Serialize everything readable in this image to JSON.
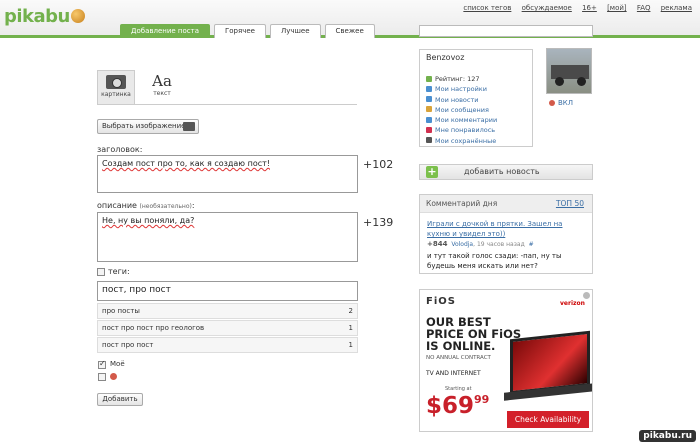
{
  "header": {
    "logo": "pikabu",
    "toplinks": [
      "список тегов",
      "обсуждаемое",
      "16+",
      "[мой]",
      "FAQ",
      "реклама"
    ],
    "nav_tabs": [
      "Добавление поста",
      "Горячее",
      "Лучшее",
      "Свежее"
    ]
  },
  "editor": {
    "type_tab_picture": "картинка",
    "type_tab_text_glyph": "Aa",
    "type_tab_text": "текст",
    "select_image_label": "Выбрать изображение",
    "title_label": "заголовок:",
    "title_value": "Создам пост про то, как я создаю пост!",
    "title_counter": "+102",
    "desc_label": "описание",
    "desc_label_note": "(необязательно)",
    "desc_value": "Не, ну вы поняли, да?",
    "desc_counter": "+139",
    "tags_label": "теги:",
    "tags_value": "пост, про пост",
    "tag_suggestions": [
      {
        "name": "про посты",
        "count": "2"
      },
      {
        "name": "пост про пост про геологов",
        "count": "1"
      },
      {
        "name": "пост про пост",
        "count": "1"
      }
    ],
    "moe_label": "Моё",
    "add_button": "Добавить"
  },
  "sidebar": {
    "username": "Benzovoz",
    "menu": [
      {
        "label": "Рейтинг: 127",
        "color": "#73b14d"
      },
      {
        "label": "Мои настройки",
        "color": "#4a8fd0"
      },
      {
        "label": "Мои новости",
        "color": "#4a8fd0"
      },
      {
        "label": "Мои сообщения",
        "color": "#d8a33a"
      },
      {
        "label": "Мои комментарии",
        "color": "#4a8fd0"
      },
      {
        "label": "Мне понравилось",
        "color": "#d03050"
      },
      {
        "label": "Мои сохранённые",
        "color": "#555555"
      }
    ],
    "vkl_label": "ВКЛ",
    "add_news": "добавить новость",
    "comment_day_title": "Комментарий дня",
    "top50": "ТОП 50",
    "comment_link": "Играли с дочкой в прятки. Зашел на кухню и увидел это))",
    "comment_score": "+844",
    "comment_author": "Volodja",
    "comment_time": ", 19 часов назад",
    "comment_hash": "#",
    "comment_text": "и тут такой голос сзади: -пап, ну ты будешь меня искать или нет?"
  },
  "ad": {
    "brand": "FiOS",
    "sponsor": "verizon",
    "headline_1": "OUR BEST",
    "headline_2": "PRICE ON FiOS",
    "headline_3": "IS ONLINE.",
    "no_contract": "NO ANNUAL CONTRACT",
    "tv_internet": "TV AND INTERNET",
    "starting": "Starting at",
    "price_main": "$69",
    "price_cents": "99",
    "cta": "Check Availability"
  },
  "watermark": "pikabu.ru"
}
